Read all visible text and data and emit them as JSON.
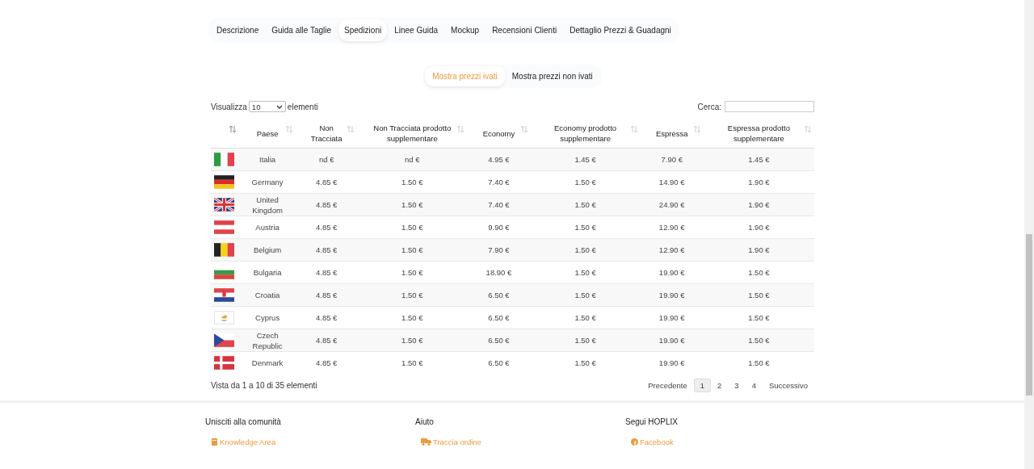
{
  "tabs": [
    {
      "label": "Descrizione",
      "selected": false
    },
    {
      "label": "Guida alle Taglie",
      "selected": false
    },
    {
      "label": "Spedizioni",
      "selected": true
    },
    {
      "label": "Linee Guida",
      "selected": false
    },
    {
      "label": "Mockup",
      "selected": false
    },
    {
      "label": "Recensioni Clienti",
      "selected": false
    },
    {
      "label": "Dettaglio Prezzi & Guadagni",
      "selected": false
    }
  ],
  "price_toggle": [
    {
      "label": "Mostra prezzi ivati",
      "selected": true
    },
    {
      "label": "Mostra prezzi non ivati",
      "selected": false
    }
  ],
  "length_control": {
    "label_before": "Visualizza",
    "value": "10",
    "label_after": "elementi"
  },
  "search": {
    "label": "Cerca:"
  },
  "table": {
    "columns": [
      "Paese",
      "Non Tracciata",
      "Non Tracciata prodotto supplementare",
      "Economy",
      "Economy prodotto supplementare",
      "Espressa",
      "Espressa prodotto supplementare"
    ],
    "rows": [
      [
        "Italia",
        "nd €",
        "nd €",
        "4.95 €",
        "1.45 €",
        "7.90 €",
        "1.45 €"
      ],
      [
        "Germany",
        "4.85 €",
        "1.50 €",
        "7.40 €",
        "1.50 €",
        "14.90 €",
        "1.90 €"
      ],
      [
        "United Kingdom",
        "4.85 €",
        "1.50 €",
        "7.40 €",
        "1.50 €",
        "24.90 €",
        "1.90 €"
      ],
      [
        "Austria",
        "4.85 €",
        "1.50 €",
        "9.90 €",
        "1.50 €",
        "12.90 €",
        "1.90 €"
      ],
      [
        "Belgium",
        "4.85 €",
        "1.50 €",
        "7.90 €",
        "1.50 €",
        "12.90 €",
        "1.90 €"
      ],
      [
        "Bulgaria",
        "4.85 €",
        "1.50 €",
        "18.90 €",
        "1.50 €",
        "19.90 €",
        "1.50 €"
      ],
      [
        "Croatia",
        "4.85 €",
        "1.50 €",
        "6.50 €",
        "1.50 €",
        "19.90 €",
        "1.50 €"
      ],
      [
        "Cyprus",
        "4.85 €",
        "1.50 €",
        "6.50 €",
        "1.50 €",
        "19.90 €",
        "1.50 €"
      ],
      [
        "Czech Republic",
        "4.85 €",
        "1.50 €",
        "6.50 €",
        "1.50 €",
        "19.90 €",
        "1.50 €"
      ],
      [
        "Denmark",
        "4.85 €",
        "1.50 €",
        "6.50 €",
        "1.50 €",
        "19.90 €",
        "1.50 €"
      ]
    ]
  },
  "table_info": "Vista da 1 a 10 di 35 elementi",
  "pagination": [
    {
      "label": "Precedente",
      "selected": false
    },
    {
      "label": "1",
      "selected": true
    },
    {
      "label": "2",
      "selected": false
    },
    {
      "label": "3",
      "selected": false
    },
    {
      "label": "4",
      "selected": false
    },
    {
      "label": "Successivo",
      "selected": false
    }
  ],
  "footer": [
    {
      "title": "Unisciti alla comunità",
      "links": [
        "Knowledge Area"
      ]
    },
    {
      "title": "Aiuto",
      "links": [
        "Traccia ordine"
      ]
    },
    {
      "title": "Segui HOPLIX",
      "links": [
        "Facebook"
      ]
    }
  ]
}
